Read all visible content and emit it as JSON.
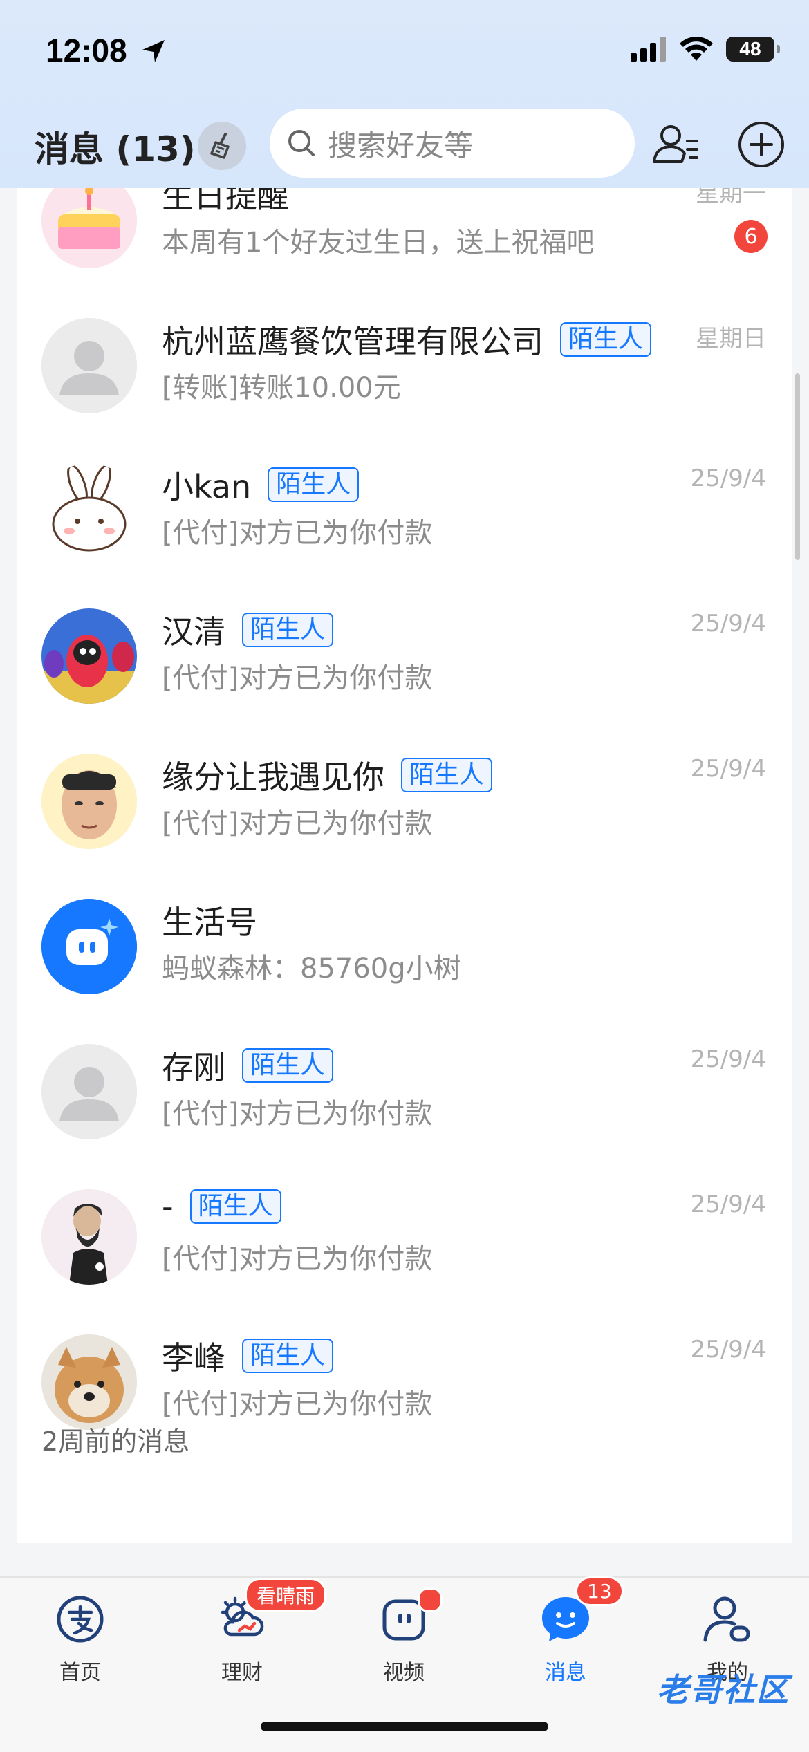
{
  "status_bar": {
    "time": "12:08",
    "battery": "48"
  },
  "header": {
    "title": "消息 (13)",
    "search_placeholder": "搜索好友等"
  },
  "conversations": [
    {
      "name": "生日提醒",
      "tag": "",
      "preview": "本周有1个好友过生日，送上祝福吧",
      "time": "星期一",
      "unread": "6"
    },
    {
      "name": "杭州蓝鹰餐饮管理有限公司",
      "tag": "陌生人",
      "preview": "[转账]转账10.00元",
      "time": "星期日"
    },
    {
      "name": "小kan",
      "tag": "陌生人",
      "preview": "[代付]对方已为你付款",
      "time": "25/9/4"
    },
    {
      "name": "汉清",
      "tag": "陌生人",
      "preview": "[代付]对方已为你付款",
      "time": "25/9/4"
    },
    {
      "name": "缘分让我遇见你",
      "tag": "陌生人",
      "preview": "[代付]对方已为你付款",
      "time": "25/9/4"
    },
    {
      "name": "生活号",
      "tag": "",
      "preview": "蚂蚁森林：85760g小树",
      "time": ""
    },
    {
      "name": "存刚",
      "tag": "陌生人",
      "preview": "[代付]对方已为你付款",
      "time": "25/9/4"
    },
    {
      "name": "-",
      "tag": "陌生人",
      "preview": "[代付]对方已为你付款",
      "time": "25/9/4"
    },
    {
      "name": "李峰",
      "tag": "陌生人",
      "preview": "[代付]对方已为你付款",
      "time": "25/9/4"
    }
  ],
  "section_title": "2周前的消息",
  "tabbar": {
    "items": [
      {
        "label": "首页"
      },
      {
        "label": "理财",
        "badge": "看晴雨"
      },
      {
        "label": "视频"
      },
      {
        "label": "消息",
        "badge": "13"
      },
      {
        "label": "我的"
      }
    ]
  },
  "watermark": "老哥社区",
  "colors": {
    "accent": "#1677ff",
    "badge": "#f2453b",
    "header_bg": "#dce9fb"
  },
  "icons": [
    "location-arrow-icon",
    "signal-icon",
    "wifi-icon",
    "battery-icon",
    "broom-icon",
    "search-icon",
    "contacts-icon",
    "add-circle-icon"
  ]
}
